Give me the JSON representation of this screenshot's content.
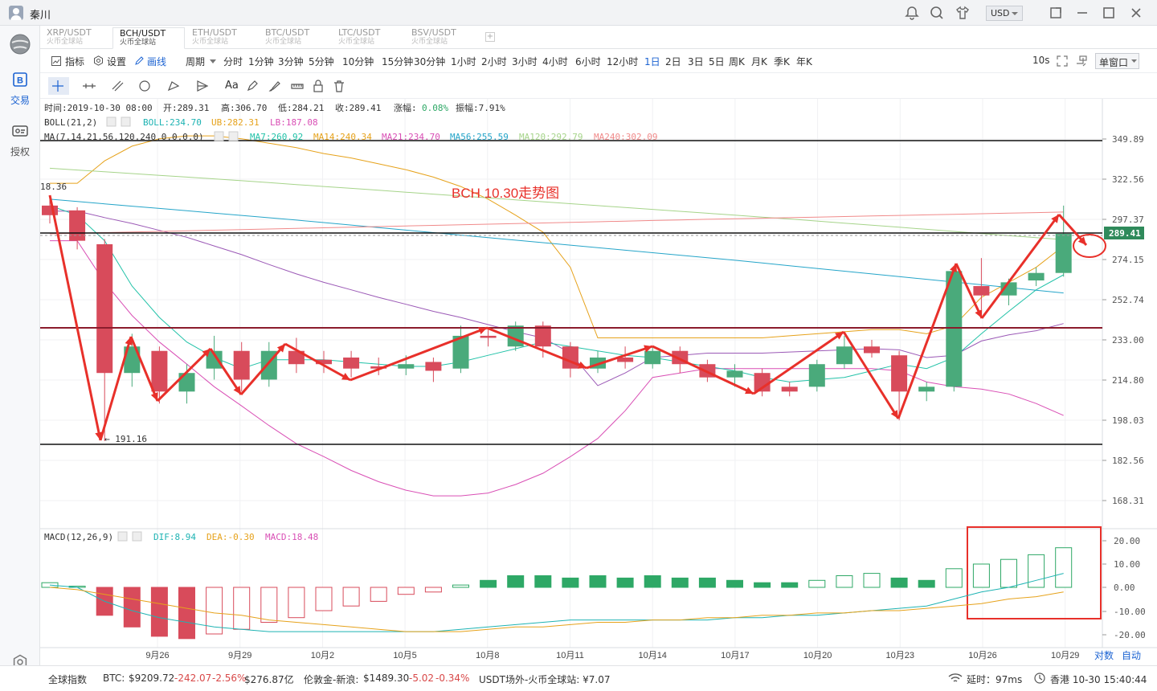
{
  "window": {
    "user_name": "秦川",
    "currency": "USD"
  },
  "sidebar": {
    "items": [
      {
        "label": "交易"
      },
      {
        "label": "授权"
      }
    ]
  },
  "pair_tabs": [
    {
      "pair": "XRP/USDT",
      "source": "火币全球站"
    },
    {
      "pair": "BCH/USDT",
      "source": "火币全球站"
    },
    {
      "pair": "ETH/USDT",
      "source": "火币全球站"
    },
    {
      "pair": "BTC/USDT",
      "source": "火币全球站"
    },
    {
      "pair": "LTC/USDT",
      "source": "火币全球站"
    },
    {
      "pair": "BSV/USDT",
      "source": "火币全球站"
    }
  ],
  "toolbar": {
    "indicator": "指标",
    "settings": "设置",
    "draw": "画线",
    "period": "周期",
    "periods": [
      "分时",
      "1分钟",
      "3分钟",
      "5分钟",
      "10分钟",
      "15分钟",
      "30分钟",
      "1小时",
      "2小时",
      "3小时",
      "4小时",
      "6小时",
      "12小时",
      "1日",
      "2日",
      "3日",
      "5日",
      "周K",
      "月K",
      "季K",
      "年K"
    ],
    "active_period": "1日",
    "refresh": "10s",
    "window_mode": "单窗口"
  },
  "draw_tools": [
    "crosshair",
    "horizontal-line",
    "parallel-lines",
    "circle",
    "arrow",
    "text",
    "marker",
    "pencil",
    "measure",
    "lock",
    "delete"
  ],
  "draw_text_tool": "Aa",
  "info": {
    "time": "时间:2019-10-30 08:00",
    "open": "开:289.31",
    "high": "高:306.70",
    "low": "低:284.21",
    "close": "收:289.41",
    "change_label": "涨幅:",
    "change": "0.08%",
    "amplitude": "振幅:7.91%"
  },
  "boll": {
    "label": "BOLL(21,2)",
    "boll": "BOLL:234.70",
    "ub": "UB:282.31",
    "lb": "LB:187.08"
  },
  "ma": {
    "label": "MA(7,14,21,56,120,240,0,0,0,0)",
    "ma7": "MA7:260.92",
    "ma14": "MA14:240.34",
    "ma21": "MA21:234.70",
    "ma56": "MA56:255.59",
    "ma120": "MA120:292.79",
    "ma240": "MA240:302.09"
  },
  "macd": {
    "label": "MACD(12,26,9)",
    "dif": "DIF:8.94",
    "dea": "DEA:-0.30",
    "macd": "MACD:18.48"
  },
  "annotation": {
    "title": "BCH 10.30走势图",
    "high_label": "18.36",
    "low_label": "← 191.16"
  },
  "colors": {
    "up": "#d84b5b",
    "down": "#4aaa7b",
    "accent": "#1c63d2",
    "arrow": "#e8302a"
  },
  "chart_data": {
    "type": "candlestick",
    "title": "BCH 10.30走势图",
    "price_axis_ticks": [
      "349.89",
      "322.56",
      "297.37",
      "274.15",
      "252.74",
      "233.00",
      "214.80",
      "198.03",
      "182.56",
      "168.31"
    ],
    "last_price": "289.41",
    "macd_axis_ticks": [
      "20.00",
      "10.00",
      "0.00",
      "-10.00",
      "-20.00"
    ],
    "x_labels": [
      "9月26",
      "9月29",
      "10月2",
      "10月5",
      "10月8",
      "10月11",
      "10月14",
      "10月17",
      "10月20",
      "10月23",
      "10月26",
      "10月29"
    ],
    "axis_buttons": [
      "对数",
      "自动"
    ],
    "dates": [
      "9-23",
      "9-24",
      "9-25",
      "9-26",
      "9-27",
      "9-28",
      "9-29",
      "9-30",
      "10-1",
      "10-2",
      "10-3",
      "10-4",
      "10-5",
      "10-6",
      "10-7",
      "10-8",
      "10-9",
      "10-10",
      "10-11",
      "10-12",
      "10-13",
      "10-14",
      "10-15",
      "10-16",
      "10-17",
      "10-18",
      "10-19",
      "10-20",
      "10-21",
      "10-22",
      "10-23",
      "10-24",
      "10-25",
      "10-26",
      "10-27",
      "10-28",
      "10-29",
      "10-30"
    ],
    "candles": [
      {
        "o": 306,
        "c": 300,
        "h": 310,
        "l": 295
      },
      {
        "o": 303,
        "c": 285,
        "h": 305,
        "l": 280
      },
      {
        "o": 283,
        "c": 218,
        "h": 286,
        "l": 190
      },
      {
        "o": 218,
        "c": 230,
        "h": 236,
        "l": 212
      },
      {
        "o": 228,
        "c": 210,
        "h": 230,
        "l": 205
      },
      {
        "o": 210,
        "c": 218,
        "h": 222,
        "l": 205
      },
      {
        "o": 220,
        "c": 228,
        "h": 235,
        "l": 215
      },
      {
        "o": 228,
        "c": 215,
        "h": 232,
        "l": 210
      },
      {
        "o": 215,
        "c": 228,
        "h": 232,
        "l": 212
      },
      {
        "o": 228,
        "c": 222,
        "h": 234,
        "l": 218
      },
      {
        "o": 224,
        "c": 222,
        "h": 228,
        "l": 218
      },
      {
        "o": 225,
        "c": 220,
        "h": 228,
        "l": 216
      },
      {
        "o": 221,
        "c": 220,
        "h": 225,
        "l": 217
      },
      {
        "o": 220,
        "c": 222,
        "h": 226,
        "l": 217
      },
      {
        "o": 223,
        "c": 219,
        "h": 225,
        "l": 214
      },
      {
        "o": 220,
        "c": 235,
        "h": 240,
        "l": 218
      },
      {
        "o": 235,
        "c": 234,
        "h": 238,
        "l": 230
      },
      {
        "o": 230,
        "c": 240,
        "h": 242,
        "l": 228
      },
      {
        "o": 240,
        "c": 230,
        "h": 242,
        "l": 225
      },
      {
        "o": 230,
        "c": 220,
        "h": 232,
        "l": 216
      },
      {
        "o": 220,
        "c": 225,
        "h": 228,
        "l": 218
      },
      {
        "o": 225,
        "c": 223,
        "h": 230,
        "l": 220
      },
      {
        "o": 222,
        "c": 228,
        "h": 230,
        "l": 220
      },
      {
        "o": 228,
        "c": 222,
        "h": 230,
        "l": 218
      },
      {
        "o": 222,
        "c": 216,
        "h": 224,
        "l": 214
      },
      {
        "o": 216,
        "c": 219,
        "h": 222,
        "l": 212
      },
      {
        "o": 218,
        "c": 210,
        "h": 220,
        "l": 208
      },
      {
        "o": 212,
        "c": 210,
        "h": 214,
        "l": 208
      },
      {
        "o": 212,
        "c": 222,
        "h": 224,
        "l": 210
      },
      {
        "o": 222,
        "c": 230,
        "h": 235,
        "l": 220
      },
      {
        "o": 230,
        "c": 227,
        "h": 233,
        "l": 225
      },
      {
        "o": 226,
        "c": 210,
        "h": 228,
        "l": 198
      },
      {
        "o": 210,
        "c": 212,
        "h": 214,
        "l": 206
      },
      {
        "o": 212,
        "c": 268,
        "h": 270,
        "l": 210
      },
      {
        "o": 260,
        "c": 255,
        "h": 275,
        "l": 248
      },
      {
        "o": 255,
        "c": 262,
        "h": 264,
        "l": 250
      },
      {
        "o": 263,
        "c": 267,
        "h": 270,
        "l": 260
      },
      {
        "o": 267,
        "c": 289,
        "h": 306,
        "l": 265
      }
    ],
    "macd_hist": [
      2,
      0.5,
      -12,
      -17,
      -21,
      -22,
      -20,
      -18,
      -15,
      -13,
      -10,
      -8,
      -6,
      -3,
      -2,
      1,
      3,
      5,
      5,
      4,
      5,
      4,
      5,
      4,
      4,
      3,
      2,
      2,
      3,
      5,
      6,
      4,
      3,
      8,
      10,
      12,
      14,
      17,
      18
    ],
    "dif": [
      1,
      0,
      -6,
      -10,
      -13,
      -15,
      -17,
      -18,
      -19,
      -19,
      -19,
      -19,
      -19,
      -19,
      -19,
      -18,
      -17,
      -16,
      -15,
      -14,
      -14,
      -14,
      -14,
      -14,
      -14,
      -13,
      -13,
      -12,
      -12,
      -11,
      -10,
      -9,
      -8,
      -5,
      -2,
      0,
      3,
      6,
      9
    ],
    "dea": [
      0,
      -1,
      -3,
      -5,
      -7,
      -9,
      -11,
      -12,
      -14,
      -15,
      -16,
      -17,
      -18,
      -19,
      -19,
      -19,
      -18,
      -17,
      -17,
      -16,
      -15,
      -15,
      -14,
      -14,
      -13,
      -13,
      -12,
      -12,
      -11,
      -11,
      -10,
      -10,
      -9,
      -8,
      -7,
      -5,
      -4,
      -2,
      0
    ]
  }
}
